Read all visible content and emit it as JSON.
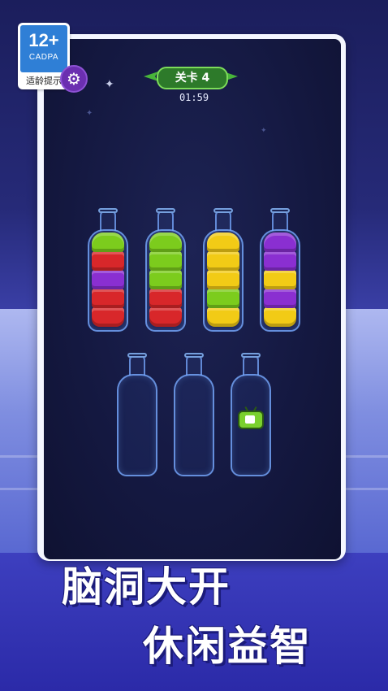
{
  "age_rating": {
    "age": "12+",
    "org": "CADPA",
    "tip": "适龄提示"
  },
  "icons": {
    "settings": "gear-icon",
    "video": "tv-play-icon"
  },
  "level": {
    "label": "关卡  4"
  },
  "timer": {
    "value": "01:59"
  },
  "colors": {
    "red": "#d8272a",
    "green": "#7ccc1d",
    "purple": "#8a2fd1",
    "yellow": "#f2cb16"
  },
  "bottles": [
    {
      "layers_bottom_to_top": [
        "red",
        "red",
        "purple",
        "red",
        "green"
      ]
    },
    {
      "layers_bottom_to_top": [
        "red",
        "red",
        "green",
        "green",
        "green"
      ]
    },
    {
      "layers_bottom_to_top": [
        "yellow",
        "green",
        "yellow",
        "yellow",
        "yellow"
      ]
    },
    {
      "layers_bottom_to_top": [
        "yellow",
        "purple",
        "yellow",
        "purple",
        "purple"
      ]
    },
    {
      "layers_bottom_to_top": []
    },
    {
      "layers_bottom_to_top": []
    },
    {
      "layers_bottom_to_top": [],
      "locked_video": true
    }
  ],
  "slogan": {
    "line1": "脑洞大开",
    "line2": "休闲益智"
  }
}
